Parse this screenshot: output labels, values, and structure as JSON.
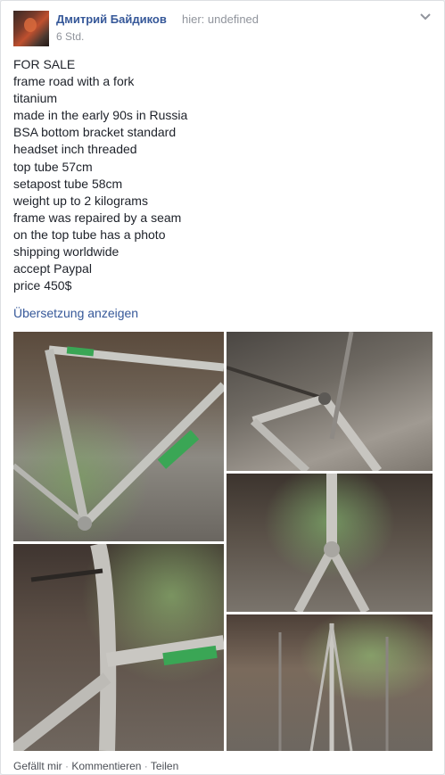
{
  "post": {
    "author": "Дмитрий Байдиков",
    "via": "hier: undefined",
    "time": "6 Std.",
    "lines": [
      "FOR SALE",
      "frame road with a fork",
      "titanium",
      "made in the early 90s in Russia",
      "BSA bottom bracket standard",
      "headset inch threaded",
      "top tube 57cm",
      "setapost tube 58cm",
      "weight up to 2 kilograms",
      "frame was repaired by a seam",
      "on the top tube has a photo",
      "shipping worldwide",
      "accept Paypal",
      "price 450$"
    ],
    "translate_link": "Übersetzung anzeigen"
  },
  "photos": [
    {
      "name": "photo-frame-overview"
    },
    {
      "name": "photo-rear-dropouts"
    },
    {
      "name": "photo-seat-tube"
    },
    {
      "name": "photo-head-tube"
    },
    {
      "name": "photo-frame-rear-view"
    }
  ],
  "actions": {
    "like": "Gefällt mir",
    "comment": "Kommentieren",
    "share": "Teilen",
    "separator": "·"
  },
  "colors": {
    "link": "#365899",
    "text": "#1d2129",
    "meta": "#90949c"
  },
  "icons": {
    "menu": "chevron-down-icon"
  }
}
